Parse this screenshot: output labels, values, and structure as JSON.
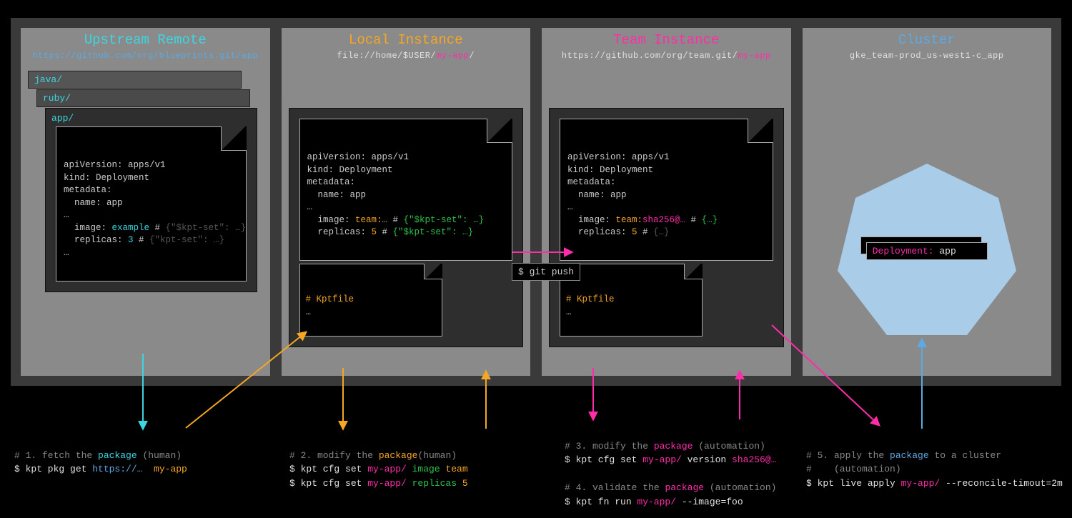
{
  "panels": {
    "upstream": {
      "title": "Upstream Remote",
      "sub": "https://github.com/org/blueprints.git/app",
      "layers": [
        "java/",
        "ruby/"
      ],
      "folder": "app/",
      "yaml": {
        "l1": "apiVersion: apps/v1",
        "l2": "kind: Deployment",
        "l3": "metadata:",
        "l4": "  name: app",
        "l5": "…",
        "l6a": "  image: ",
        "l6b": "example",
        "l6c": " # ",
        "l6d": "{\"$kpt-set\": …}",
        "l7a": "  replicas: ",
        "l7b": "3",
        "l7c": " # ",
        "l7d": "{\"kpt-set\": …}",
        "l8": "…"
      }
    },
    "local": {
      "title": "Local Instance",
      "sub_a": "file://home/$USER/",
      "sub_b": "my-app",
      "sub_c": "/",
      "yaml": {
        "l1": "apiVersion: apps/v1",
        "l2": "kind: Deployment",
        "l3": "metadata:",
        "l4": "  name: app",
        "l5": "…",
        "l6a": "  image: ",
        "l6b": "team:…",
        "l6c": " # ",
        "l6d": "{\"$kpt-set\": …}",
        "l7a": "  replicas: ",
        "l7b": "5",
        "l7c": " # ",
        "l7d": "{\"$kpt-set\": …}"
      },
      "kptfile": {
        "l1": "# Kptfile",
        "l2": "…"
      }
    },
    "team": {
      "title": "Team Instance",
      "sub_a": "https://github.com/org/team.git/",
      "sub_b": "my-app",
      "yaml": {
        "l1": "apiVersion: apps/v1",
        "l2": "kind: Deployment",
        "l3": "metadata:",
        "l4": "  name: app",
        "l5": "…",
        "l6a": "  image: ",
        "l6b": "team:",
        "l6c": "sha256@…",
        "l6d": " # ",
        "l6e": "{…}",
        "l7a": "  replicas: ",
        "l7b": "5",
        "l7c": " # ",
        "l7d": "{…}"
      },
      "kptfile": {
        "l1": "# Kptfile",
        "l2": "…"
      }
    },
    "cluster": {
      "title": "Cluster",
      "sub": "gke_team-prod_us-west1-c_app",
      "label_a": "Deployment: ",
      "label_b": "app"
    }
  },
  "git_push": "$ git push",
  "commands": {
    "c1": {
      "l1a": "# 1. fetch the ",
      "l1b": "package",
      "l1c": " (human)",
      "l2a": "$ kpt pkg get ",
      "l2b": "https://…  ",
      "l2c": "my-app"
    },
    "c2": {
      "l1a": "# 2. modify the ",
      "l1b": "package",
      "l1c": "(human)",
      "l2a": "$ kpt cfg set ",
      "l2b": "my-app/",
      "l2c": " image ",
      "l2d": "team",
      "l3a": "$ kpt cfg set ",
      "l3b": "my-app/",
      "l3c": " replicas ",
      "l3d": "5"
    },
    "c3": {
      "l1a": "# 3. modify the ",
      "l1b": "package",
      "l1c": " (automation)",
      "l2a": "$ kpt cfg set ",
      "l2b": "my-app/",
      "l2c": " version ",
      "l2d": "sha256@…",
      "gap": "",
      "l3a": "# 4. validate the ",
      "l3b": "package",
      "l3c": " (automation)",
      "l4a": "$ kpt fn run ",
      "l4b": "my-app/",
      "l4c": " --image=foo"
    },
    "c5": {
      "l1a": "# 5. apply the ",
      "l1b": "package",
      "l1c": " to a cluster",
      "l2": "#    (automation)",
      "l3a": "$ kpt live apply ",
      "l3b": "my-app/",
      "l3c": " --reconcile-timout=2m"
    }
  }
}
